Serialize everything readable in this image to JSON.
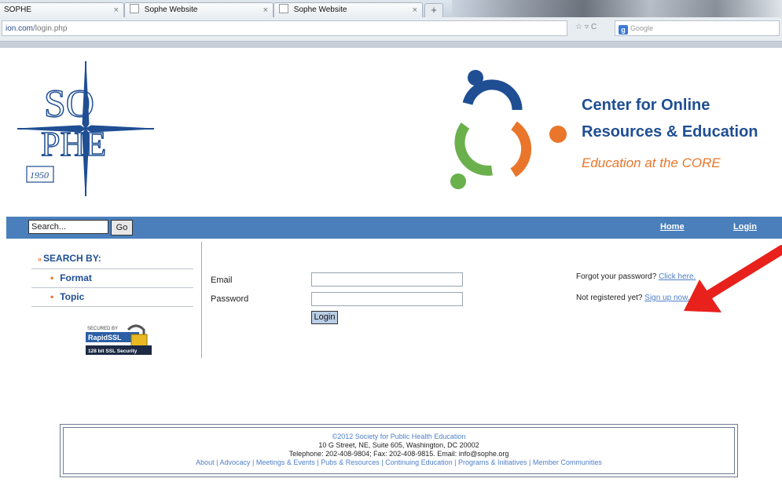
{
  "browser": {
    "tabs": [
      {
        "title": "SOPHE"
      },
      {
        "title": "Sophe Website"
      },
      {
        "title": "Sophe Website"
      }
    ],
    "new_tab_label": "+",
    "url_main": "ion.com",
    "url_path": "/login.php",
    "search_engine": "Google"
  },
  "header": {
    "sophe_year": "1950",
    "core_title_line1": "Center for Online",
    "core_title_line2": "Resources & Education",
    "core_tagline": "Education at the CORE"
  },
  "nav": {
    "search_placeholder": "Search...",
    "go_label": "Go",
    "home_label": "Home",
    "login_label": "Login"
  },
  "sidebar": {
    "heading": "SEARCH BY:",
    "items": [
      {
        "label": "Format"
      },
      {
        "label": "Topic"
      }
    ],
    "ssl_line1": "SECURED BY",
    "ssl_line2": "RapidSSL",
    "ssl_line3": "128 bit SSL Security"
  },
  "form": {
    "email_label": "Email",
    "password_label": "Password",
    "email_value": "",
    "password_value": "",
    "login_button": "Login",
    "forgot_text": "Forgot your password?",
    "forgot_link": "Click here.",
    "register_text": "Not registered yet?",
    "register_link": "Sign up now."
  },
  "footer": {
    "copyright": "©2012 Society for Public Health Education",
    "address": "10 G Street, NE, Suite 605, Washington, DC 20002",
    "contact": "Telephone: 202-408-9804; Fax: 202-408-9815. Email: info@sophe.org",
    "links": [
      "About",
      "Advocacy",
      "Meetings & Events",
      "Pubs & Resources",
      "Continuing Education",
      "Programs & Initiatives",
      "Member Communities"
    ]
  },
  "colors": {
    "nav_blue": "#4a7fbb",
    "brand_blue": "#1f4e93",
    "brand_orange": "#e9762a",
    "brand_green": "#6ab04c",
    "arrow_red": "#e8211d"
  }
}
